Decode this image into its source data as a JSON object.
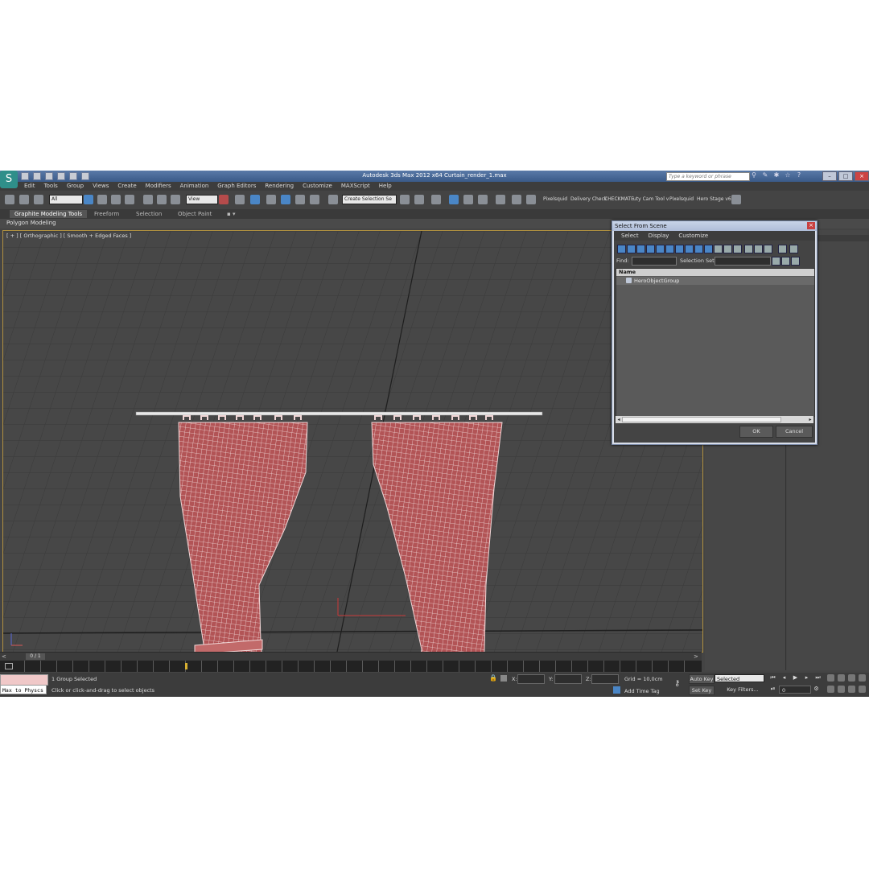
{
  "window": {
    "title": "Autodesk 3ds Max  2012 x64     Curtain_render_1.max",
    "search_placeholder": "Type a keyword or phrase"
  },
  "menu": [
    "Edit",
    "Tools",
    "Group",
    "Views",
    "Create",
    "Modifiers",
    "Animation",
    "Graph Editors",
    "Rendering",
    "Customize",
    "MAXScript",
    "Help"
  ],
  "toolbar": {
    "filter_value": "All",
    "refcoord_value": "View",
    "named_selection_value": "Create Selection Se",
    "plugins": [
      "Pixelsquid",
      "Delivery Check",
      "CHECKMATE",
      "uty Cam Tool v",
      "Pixelsquid",
      "Hero Stage v6"
    ]
  },
  "ribbon": {
    "tabs": [
      "Graphite Modeling Tools",
      "Freeform",
      "Selection",
      "Object Paint"
    ],
    "sub_label": "Polygon Modeling"
  },
  "viewport": {
    "label": "[ + ] [ Orthographic ] [ Smooth + Edged Faces ]",
    "wire_color": "#f0d6d6",
    "mesh_color": "#b25456"
  },
  "dialog": {
    "title": "Select From Scene",
    "menu": [
      "Select",
      "Display",
      "Customize"
    ],
    "find_label": "Find:",
    "selection_set_label": "Selection Set:",
    "list_header": "Name",
    "rows": [
      "HeroObjectGroup"
    ],
    "ok": "OK",
    "cancel": "Cancel"
  },
  "timeslider": {
    "label": "0 / 1"
  },
  "status": {
    "maxscript_listener": "Max to Physcs",
    "selection": "1 Group Selected",
    "prompt": "Click or click-and-drag to select objects",
    "x_label": "X:",
    "y_label": "Y:",
    "z_label": "Z:",
    "grid": "Grid = 10,0cm",
    "add_time_tag": "Add Time Tag",
    "auto_key": "Auto Key",
    "set_key": "Set Key",
    "selected_value": "Selected",
    "key_filters": "Key Filters...",
    "frame_value": "0"
  },
  "colors": {
    "accent": "#4a86c6",
    "viewport_border": "#b09040",
    "key_marker": "#d8b030"
  }
}
